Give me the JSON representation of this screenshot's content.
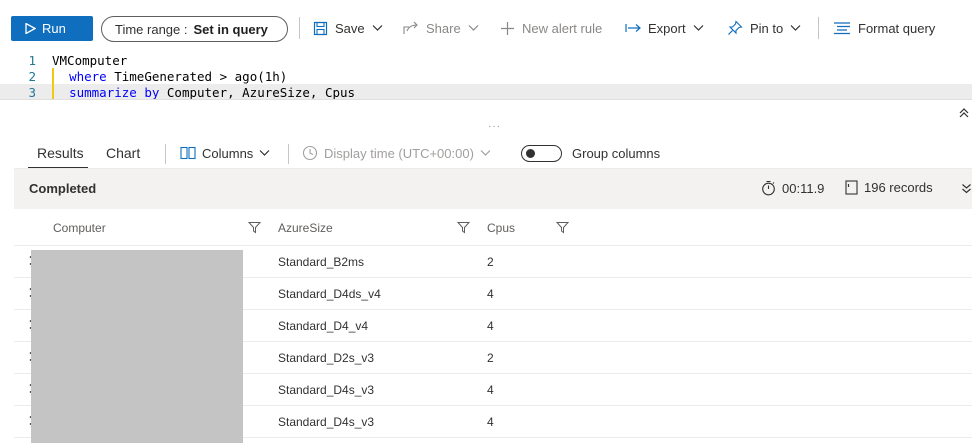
{
  "toolbar": {
    "run_label": "Run",
    "time_range_label": "Time range :",
    "time_range_value": "Set in query",
    "save_label": "Save",
    "share_label": "Share",
    "new_alert_label": "New alert rule",
    "export_label": "Export",
    "pin_label": "Pin to",
    "format_label": "Format query"
  },
  "editor": {
    "lines": [
      {
        "num": "1",
        "pipe": "",
        "keyword": "",
        "rest": "VMComputer"
      },
      {
        "num": "2",
        "pipe": "| ",
        "keyword": "where",
        "rest": " TimeGenerated > ago(1h)"
      },
      {
        "num": "3",
        "pipe": "| ",
        "keyword": "summarize by",
        "rest": " Computer, AzureSize, Cpus"
      }
    ]
  },
  "results_bar": {
    "tabs": [
      "Results",
      "Chart"
    ],
    "active_tab": "Results",
    "columns_label": "Columns",
    "display_time_label": "Display time (UTC+00:00)",
    "group_columns_label": "Group columns",
    "group_columns_on": false
  },
  "status": {
    "state": "Completed",
    "duration": "00:11.9",
    "records": "196 records"
  },
  "grid": {
    "columns": [
      "Computer",
      "AzureSize",
      "Cpus"
    ],
    "rows": [
      {
        "computer": "",
        "azure_size": "Standard_B2ms",
        "cpus": "2"
      },
      {
        "computer": "",
        "azure_size": "Standard_D4ds_v4",
        "cpus": "4"
      },
      {
        "computer": "",
        "azure_size": "Standard_D4_v4",
        "cpus": "4"
      },
      {
        "computer": "",
        "azure_size": "Standard_D2s_v3",
        "cpus": "2"
      },
      {
        "computer": "",
        "azure_size": "Standard_D4s_v3",
        "cpus": "4"
      },
      {
        "computer": "",
        "azure_size": "Standard_D4s_v3",
        "cpus": "4"
      }
    ]
  },
  "colors": {
    "accent": "#106ebe",
    "keyword": "#0000ff",
    "line_number": "#237893",
    "indent_guide": "#f2c811",
    "redaction": "#c4c4c4"
  },
  "icons": [
    "play-icon",
    "save-icon",
    "share-icon",
    "plus-icon",
    "export-icon",
    "pin-icon",
    "format-icon",
    "chevron-down-icon",
    "collapse-up-icon",
    "columns-icon",
    "clock-icon",
    "stopwatch-icon",
    "records-icon",
    "filter-icon",
    "chevron-right-icon"
  ]
}
